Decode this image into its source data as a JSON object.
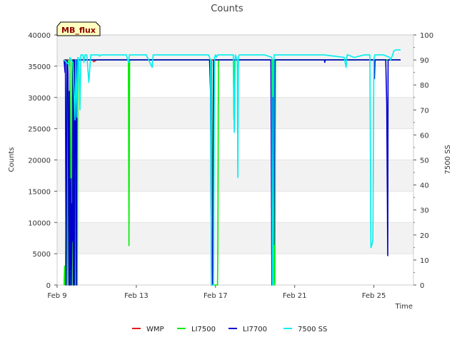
{
  "chart_data": {
    "type": "line",
    "title": "Counts",
    "xlabel": "Time",
    "ylabel": "Counts",
    "y2label": "7500 SS",
    "badge": "MB_flux",
    "x_ticks": [
      "Feb 9",
      "Feb 13",
      "Feb 17",
      "Feb 21",
      "Feb 25"
    ],
    "x_tick_days": [
      9,
      13,
      17,
      21,
      25
    ],
    "xlim": [
      9,
      27
    ],
    "ylim": [
      0,
      40000
    ],
    "y_ticks": [
      0,
      5000,
      10000,
      15000,
      20000,
      25000,
      30000,
      35000,
      40000
    ],
    "y2lim": [
      0,
      100
    ],
    "y2_ticks": [
      0,
      10,
      20,
      30,
      40,
      50,
      60,
      70,
      80,
      90,
      100
    ],
    "grid": "horizontal-bands",
    "legend_position": "bottom",
    "series": [
      {
        "name": "WMP",
        "color": "#e41a1c",
        "axis": "left",
        "x": [
          9.35,
          10.8,
          10.85,
          11.0,
          26.35
        ],
        "y": [
          36000,
          36000,
          35700,
          36000,
          36000
        ]
      },
      {
        "name": "LI7500",
        "color": "#00ee00",
        "axis": "left",
        "x": [
          9.35,
          9.38,
          9.4,
          9.42,
          9.45,
          9.5,
          9.52,
          9.55,
          9.6,
          9.62,
          9.65,
          9.7,
          9.75,
          9.8,
          9.85,
          9.9,
          9.95,
          10.0,
          10.02,
          10.05,
          10.1,
          12.6,
          12.63,
          12.66,
          12.7,
          16.8,
          16.85,
          17.1,
          17.12,
          17.15,
          17.2,
          17.9,
          17.93,
          17.96,
          18.0,
          19.9,
          19.93,
          19.97,
          20.0,
          20.03,
          26.35
        ],
        "y": [
          0,
          3000,
          0,
          1500,
          10500,
          36000,
          0,
          36000,
          0,
          18000,
          36000,
          0,
          36000,
          0,
          36000,
          0,
          36000,
          0,
          0,
          36000,
          36000,
          36000,
          6300,
          36000,
          36000,
          36000,
          0,
          0,
          6000,
          36000,
          36000,
          36000,
          26500,
          36000,
          36000,
          36000,
          0,
          6500,
          0,
          36000,
          36000
        ]
      },
      {
        "name": "LI7700",
        "color": "#0000cc",
        "axis": "left",
        "x": [
          9.35,
          9.4,
          9.42,
          9.45,
          9.5,
          9.55,
          9.6,
          9.62,
          9.65,
          9.7,
          9.72,
          9.75,
          9.78,
          9.8,
          9.82,
          9.85,
          9.87,
          9.9,
          9.93,
          9.97,
          10.0,
          10.05,
          10.1,
          16.7,
          16.75,
          16.8,
          16.85,
          16.9,
          19.8,
          19.85,
          19.9,
          19.95,
          20.0,
          22.5,
          22.52,
          22.55,
          25.0,
          25.03,
          25.06,
          25.1,
          25.6,
          25.65,
          25.7,
          25.72,
          26.0,
          26.05,
          26.35
        ],
        "y": [
          36000,
          34000,
          36000,
          0,
          36000,
          34000,
          0,
          31000,
          0,
          17000,
          0,
          13000,
          7000,
          36000,
          0,
          36000,
          0,
          36000,
          36000,
          0,
          36000,
          36000,
          36000,
          36000,
          31000,
          0,
          0,
          36000,
          36000,
          0,
          30000,
          6500,
          36000,
          36000,
          35600,
          36000,
          36000,
          33000,
          36000,
          36000,
          36000,
          29000,
          4700,
          36000,
          36000,
          36000,
          36000
        ]
      },
      {
        "name": "7500 SS",
        "color": "#00eeee",
        "axis": "right",
        "x": [
          9.35,
          9.6,
          9.65,
          9.7,
          9.8,
          9.9,
          9.95,
          10.0,
          10.05,
          10.1,
          10.15,
          10.2,
          10.3,
          10.35,
          10.4,
          10.5,
          10.6,
          10.7,
          11.1,
          11.15,
          11.2,
          11.3,
          11.5,
          12.0,
          12.5,
          12.6,
          12.65,
          12.7,
          12.8,
          13.0,
          13.5,
          13.8,
          13.85,
          13.9,
          14.0,
          14.3,
          14.5,
          15.0,
          15.5,
          16.0,
          16.5,
          16.65,
          16.7,
          16.75,
          16.8,
          16.9,
          16.95,
          17.0,
          17.05,
          17.1,
          17.2,
          17.5,
          17.9,
          17.95,
          18.0,
          18.1,
          18.13,
          18.16,
          18.2,
          18.3,
          18.5,
          19.0,
          19.5,
          19.85,
          19.88,
          19.92,
          19.96,
          20.0,
          20.1,
          20.5,
          21.0,
          21.5,
          22.0,
          22.5,
          23.0,
          23.5,
          23.6,
          23.65,
          23.7,
          24.0,
          24.5,
          24.8,
          24.85,
          24.9,
          24.95,
          25.0,
          25.05,
          25.1,
          25.5,
          25.8,
          25.85,
          25.9,
          25.95,
          26.0,
          26.1,
          26.35
        ],
        "y": [
          90,
          88,
          91,
          90,
          89,
          66,
          90,
          67,
          91,
          90,
          70,
          92,
          92,
          89,
          92,
          92,
          81,
          92,
          92,
          91.5,
          92,
          92,
          92,
          92,
          92,
          89,
          92,
          92,
          92,
          92,
          92,
          87,
          92,
          92,
          92,
          92,
          92,
          92,
          92,
          92,
          92,
          92,
          91,
          90,
          0,
          0,
          91,
          92,
          91,
          92,
          92,
          92,
          92,
          61,
          92,
          90,
          43,
          91,
          92,
          92,
          92,
          92,
          92,
          91,
          0,
          0,
          92,
          92,
          92,
          92,
          92,
          92,
          92,
          92,
          91.5,
          91,
          87,
          92,
          92,
          91,
          92,
          92,
          15,
          16,
          18,
          90,
          92,
          92,
          92,
          91,
          90,
          91,
          92,
          93.5,
          94,
          94
        ]
      }
    ]
  }
}
